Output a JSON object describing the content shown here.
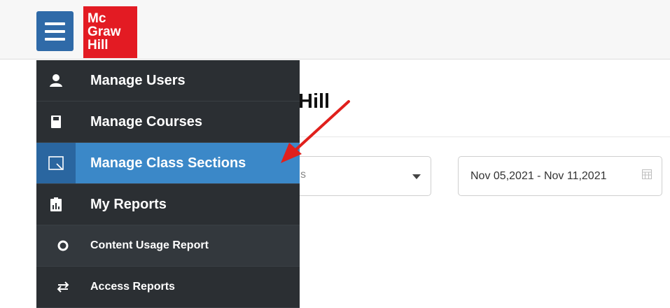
{
  "header": {
    "logo_lines": [
      "Mc",
      "Graw",
      "Hill"
    ]
  },
  "main": {
    "title": "Hill",
    "filter_select_stub": "s",
    "date_range": "Nov 05,2021 - Nov 11,2021"
  },
  "menu": {
    "items": [
      {
        "label": "Manage Users",
        "icon": "user-icon"
      },
      {
        "label": "Manage Courses",
        "icon": "book-icon"
      },
      {
        "label": "Manage Class Sections",
        "icon": "section-icon",
        "active": true
      },
      {
        "label": "My Reports",
        "icon": "report-icon"
      },
      {
        "label": "Content Usage Report",
        "icon": "circle-icon"
      },
      {
        "label": "Access Reports",
        "icon": "swap-arrows-icon"
      }
    ]
  },
  "colors": {
    "menu_bg": "#2b2f33",
    "active_item": "#3b88c8",
    "hamburger": "#2f6aa8",
    "logo_red": "#e31b23",
    "annotation_arrow": "#e0201c"
  }
}
